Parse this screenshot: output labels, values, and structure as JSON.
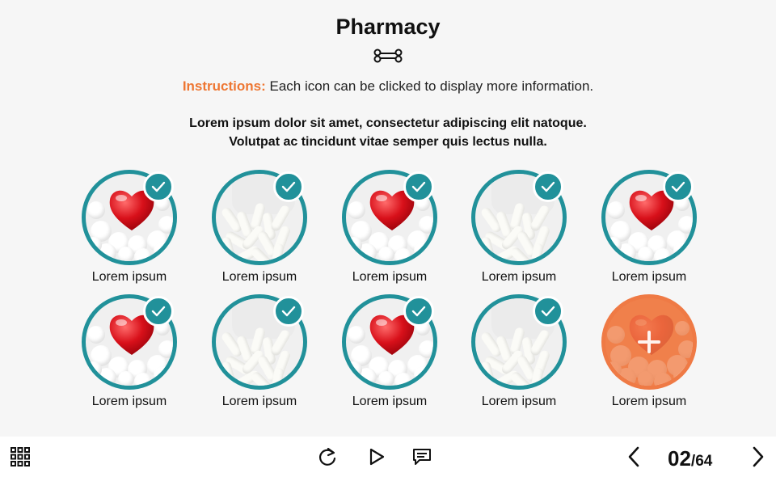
{
  "header": {
    "title": "Pharmacy",
    "instructions_lead": "Instructions:",
    "instructions_text": " Each icon can be clicked to display more information.",
    "body_line1": "Lorem ipsum dolor sit amet, consectetur adipiscing elit natoque.",
    "body_line2": "Volutpat ac tincidunt vitae semper quis lectus nulla.",
    "divider_icon": "bone-icon"
  },
  "colors": {
    "teal": "#21919a",
    "orange": "#ef7a45",
    "accent_text": "#ee7733"
  },
  "items": [
    {
      "label": "Lorem ipsum",
      "image": "heart-pills",
      "visited": true
    },
    {
      "label": "Lorem ipsum",
      "image": "capsules",
      "visited": true
    },
    {
      "label": "Lorem ipsum",
      "image": "heart-pills",
      "visited": true
    },
    {
      "label": "Lorem ipsum",
      "image": "capsules",
      "visited": true
    },
    {
      "label": "Lorem ipsum",
      "image": "heart-pills",
      "visited": true
    },
    {
      "label": "Lorem ipsum",
      "image": "heart-pills",
      "visited": true
    },
    {
      "label": "Lorem ipsum",
      "image": "capsules",
      "visited": true
    },
    {
      "label": "Lorem ipsum",
      "image": "heart-pills",
      "visited": true
    },
    {
      "label": "Lorem ipsum",
      "image": "capsules",
      "visited": true
    },
    {
      "label": "Lorem ipsum",
      "image": "heart-pills",
      "visited": false,
      "current": true
    }
  ],
  "footer": {
    "menu_icon": "grid-menu-icon",
    "replay_icon": "replay-icon",
    "play_icon": "play-icon",
    "notes_icon": "notes-icon",
    "prev_icon": "chevron-left-icon",
    "next_icon": "chevron-right-icon",
    "current_page": "02",
    "total_pages": "/64"
  }
}
